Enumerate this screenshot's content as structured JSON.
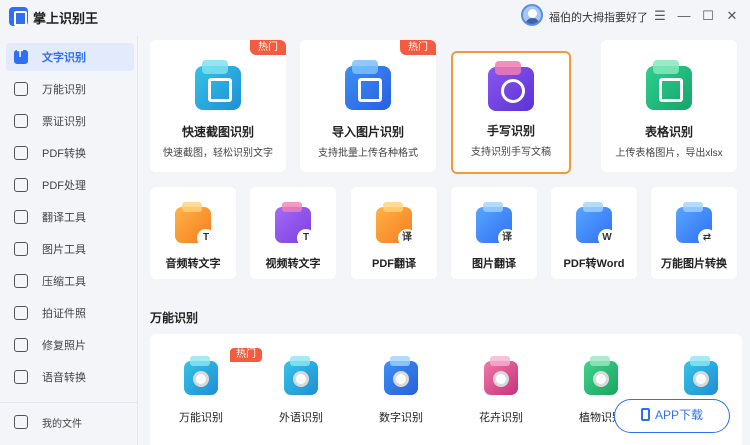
{
  "app": {
    "title": "掌上识别王",
    "user_name": "福伯的大拇指要好了",
    "window_controls": [
      "☰",
      "—",
      "☐",
      "✕"
    ]
  },
  "sidebar": {
    "items": [
      {
        "label": "文字识别",
        "icon": "text-recognition-icon",
        "active": true
      },
      {
        "label": "万能识别",
        "icon": "scan-icon"
      },
      {
        "label": "票证识别",
        "icon": "ticket-icon"
      },
      {
        "label": "PDF转换",
        "icon": "pdf-icon"
      },
      {
        "label": "PDF处理",
        "icon": "pdf-process-icon"
      },
      {
        "label": "翻译工具",
        "icon": "translate-icon"
      },
      {
        "label": "图片工具",
        "icon": "image-icon"
      },
      {
        "label": "压缩工具",
        "icon": "compress-icon"
      },
      {
        "label": "拍证件照",
        "icon": "id-photo-icon"
      },
      {
        "label": "修复照片",
        "icon": "photo-repair-icon"
      },
      {
        "label": "语音转换",
        "icon": "voice-icon"
      }
    ],
    "my_files": "我的文件"
  },
  "main": {
    "big_cards": [
      {
        "title": "快速截图识别",
        "desc": "快速截图，轻松识别文字",
        "hot": "热门",
        "icon": "screenshot-icon"
      },
      {
        "title": "导入图片识别",
        "desc": "支持批量上传各种格式",
        "hot": "热门",
        "icon": "import-image-icon"
      },
      {
        "title": "手写识别",
        "desc": "支持识别手写文稿",
        "icon": "handwriting-icon"
      },
      {
        "title": "表格识别",
        "desc": "上传表格图片，导出xlsx",
        "icon": "table-icon"
      }
    ],
    "mid_cards": [
      {
        "title": "音频转文字",
        "badge": "T",
        "icon": "audio-to-text-icon"
      },
      {
        "title": "视频转文字",
        "badge": "T",
        "icon": "video-to-text-icon"
      },
      {
        "title": "PDF翻译",
        "badge": "译",
        "icon": "pdf-translate-icon"
      },
      {
        "title": "图片翻译",
        "badge": "译",
        "icon": "image-translate-icon"
      },
      {
        "title": "PDF转Word",
        "badge": "W",
        "icon": "pdf-to-word-icon"
      },
      {
        "title": "万能图片转换",
        "badge": "⇄",
        "icon": "image-convert-icon"
      }
    ],
    "section_title": "万能识别",
    "bottom_items": [
      {
        "title": "万能识别",
        "hot": "热门",
        "icon": "universal-recognition-icon"
      },
      {
        "title": "外语识别",
        "icon": "foreign-language-icon"
      },
      {
        "title": "数字识别",
        "icon": "number-recognition-icon"
      },
      {
        "title": "花卉识别",
        "icon": "flower-recognition-icon"
      },
      {
        "title": "植物识别",
        "icon": "plant-recognition-icon"
      },
      {
        "title": "",
        "icon": "animal-recognition-icon"
      }
    ],
    "app_download": "APP下载"
  }
}
